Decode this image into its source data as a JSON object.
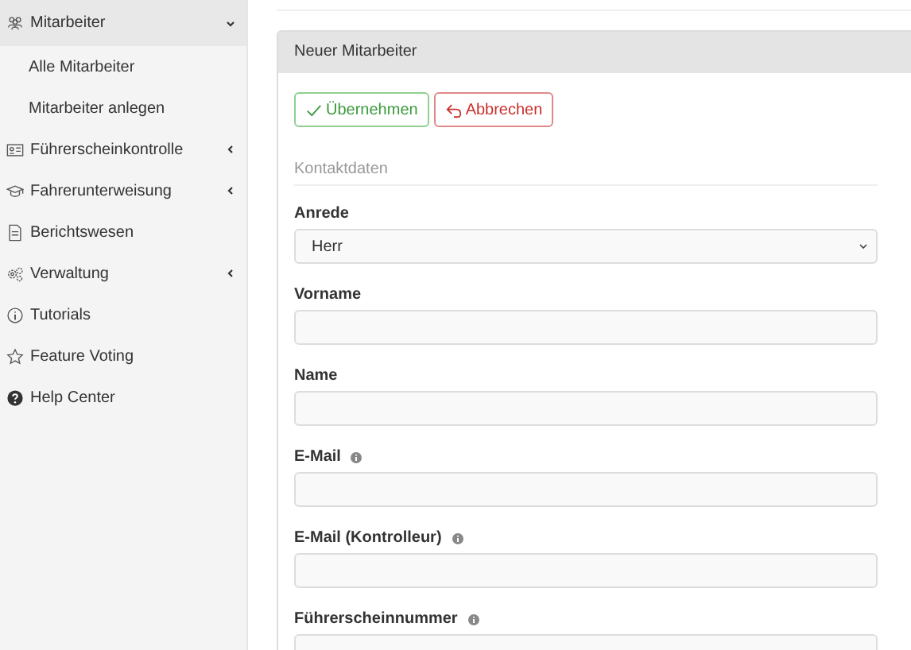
{
  "sidebar": {
    "items": [
      {
        "label": "Mitarbeiter",
        "selected": true,
        "expanded": true,
        "children": [
          {
            "label": "Alle Mitarbeiter",
            "selected": false
          },
          {
            "label": "Mitarbeiter anlegen",
            "selected": false
          }
        ]
      },
      {
        "label": "Führerscheinkontrolle",
        "selected": false,
        "expanded": false
      },
      {
        "label": "Fahrerunterweisung",
        "selected": false,
        "expanded": false
      },
      {
        "label": "Berichtswesen",
        "selected": false
      },
      {
        "label": "Verwaltung",
        "selected": false,
        "expanded": false
      },
      {
        "label": "Tutorials",
        "selected": false
      },
      {
        "label": "Feature Voting",
        "selected": false
      },
      {
        "label": "Help Center",
        "selected": false
      }
    ]
  },
  "panel": {
    "title": "Neuer Mitarbeiter",
    "buttons": [
      {
        "label": "Übernehmen",
        "kind": "confirm"
      },
      {
        "label": "Abbrechen",
        "kind": "cancel"
      }
    ],
    "section": "Kontaktdaten",
    "fields": [
      {
        "label": "Anrede",
        "kind": "select",
        "value": "Herr"
      },
      {
        "label": "Vorname",
        "kind": "text"
      },
      {
        "label": "Name",
        "kind": "text"
      },
      {
        "label": "E-Mail",
        "kind": "hinted"
      },
      {
        "label": "E-Mail (Kontrolleur)",
        "kind": "hinted"
      },
      {
        "label": "Führerscheinnummer",
        "kind": "hinted"
      }
    ]
  }
}
